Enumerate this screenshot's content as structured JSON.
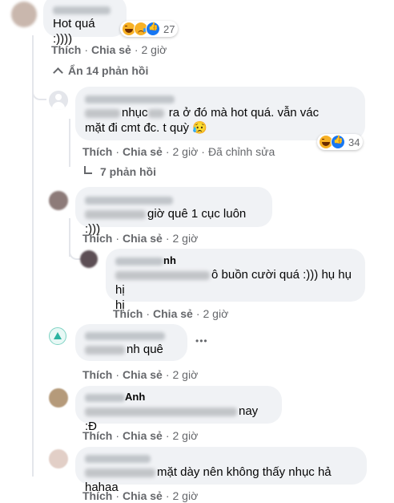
{
  "comments": [
    {
      "text": "Hot quá :))))",
      "reaction_count": "27",
      "like": "Thích",
      "share": "Chia sẻ",
      "time": "2 giờ"
    },
    {
      "hide_replies": "Ẩn 14 phản hồi"
    },
    {
      "text_a": "nhục",
      "text_b": "ra ở đó mà hot quá. vẫn vác",
      "text_c": "mặt đi cmt đc. t quỳ 😥",
      "reaction_count": "34",
      "like": "Thích",
      "share": "Chia sẻ",
      "time": "2 giờ",
      "edited": "Đã chỉnh sửa",
      "view_replies": "7 phản hồi"
    },
    {
      "text": "giờ quê 1 cục luôn :)))",
      "like": "Thích",
      "share": "Chia sẻ",
      "time": "2 giờ"
    },
    {
      "name_tail": "nh",
      "text_a": "ô buồn cười quá :))) hụ hụ hị",
      "text_b": "hị",
      "like": "Thích",
      "share": "Chia sẻ",
      "time": "2 giờ"
    },
    {
      "text": "nh quê",
      "more": "•••",
      "like": "Thích",
      "share": "Chia sẻ",
      "time": "2 giờ"
    },
    {
      "name_tail": "Anh",
      "text": "nay :Đ",
      "like": "Thích",
      "share": "Chia sẻ",
      "time": "2 giờ"
    },
    {
      "text": "mặt dày nên không thấy nhục hả hahaa",
      "like": "Thích",
      "share": "Chia sẻ",
      "time": "2 giờ"
    }
  ],
  "colors": {
    "bubble": "#f0f2f5",
    "meta": "#65676b",
    "like_blue": "#1877f2",
    "haha_yellow": "#f7b125"
  }
}
